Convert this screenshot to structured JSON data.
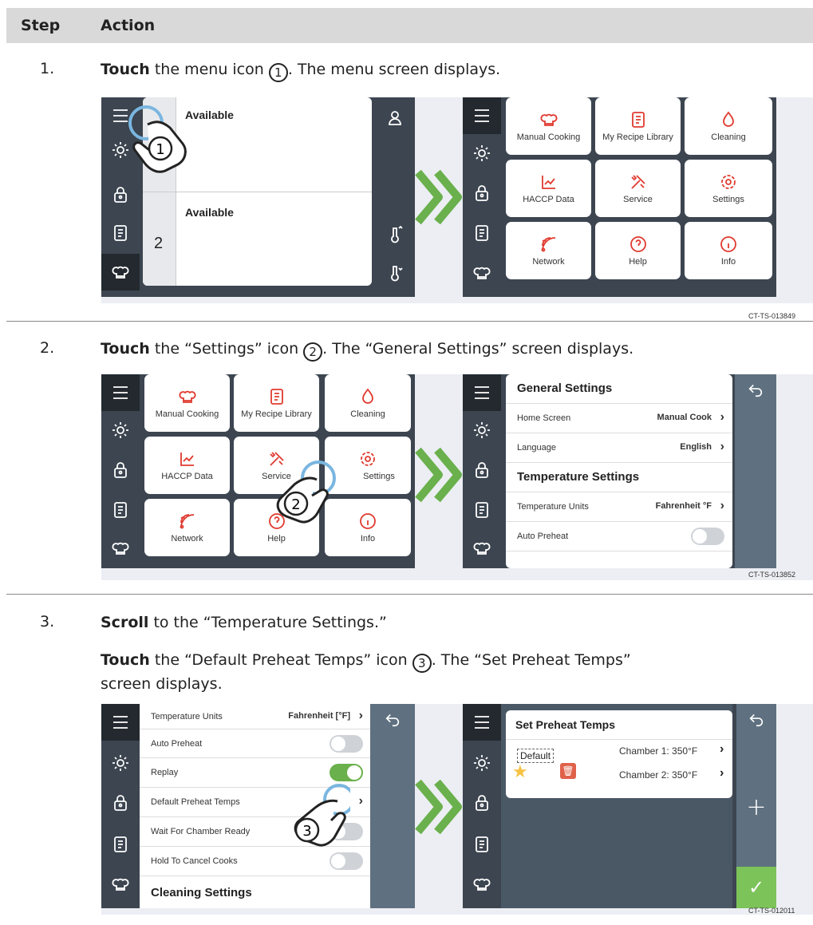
{
  "header": {
    "step": "Step",
    "action": "Action"
  },
  "steps": [
    {
      "num": "1.",
      "verb": "Touch",
      "t1": " the menu icon ",
      "circle": "1",
      "t2": ". The menu screen displays.",
      "code": "CT-TS-013849"
    },
    {
      "num": "2.",
      "verb": "Touch",
      "t1": " the “Settings” icon ",
      "circle": "2",
      "t2": ". The “General Settings” screen displays.",
      "code": "CT-TS-013852"
    },
    {
      "num": "3.",
      "verb": "Scroll",
      "t1": " to the “Temperature Settings.”",
      "verb2": "Touch",
      "t3": " the “Default Preheat Temps” icon ",
      "circle": "3",
      "t4": ". The “Set Preheat Temps”",
      "t5": "screen displays.",
      "code": "CT-TS-012011"
    }
  ],
  "home": {
    "slot1": "Available",
    "slot2": "Available",
    "num2": "2"
  },
  "menu": {
    "tiles": [
      "Manual Cooking",
      "My Recipe Library",
      "Cleaning",
      "HACCP Data",
      "Service",
      "Settings",
      "Network",
      "Help",
      "Info"
    ]
  },
  "general": {
    "title": "General Settings",
    "home_label": "Home Screen",
    "home_value": "Manual Cook",
    "lang_label": "Language",
    "lang_value": "English",
    "temp_title": "Temperature Settings",
    "units_label": "Temperature Units",
    "units_value": "Fahrenheit °F",
    "auto_label": "Auto Preheat"
  },
  "temp": {
    "units_label": "Temperature Units",
    "units_value": "Fahrenheit [°F]",
    "auto": "Auto Preheat",
    "replay": "Replay",
    "default": "Default Preheat Temps",
    "wait": "Wait For Chamber Ready",
    "hold": "Hold To Cancel Cooks",
    "cleaning": "Cleaning Settings"
  },
  "preheat": {
    "title": "Set Preheat Temps",
    "default": "Default",
    "ch1": "Chamber 1: 350°F",
    "ch2": "Chamber 2: 350°F"
  },
  "colors": {
    "accent": "#e03a2f",
    "arrow": "#6ab04c",
    "sidebar": "#3c4550"
  }
}
